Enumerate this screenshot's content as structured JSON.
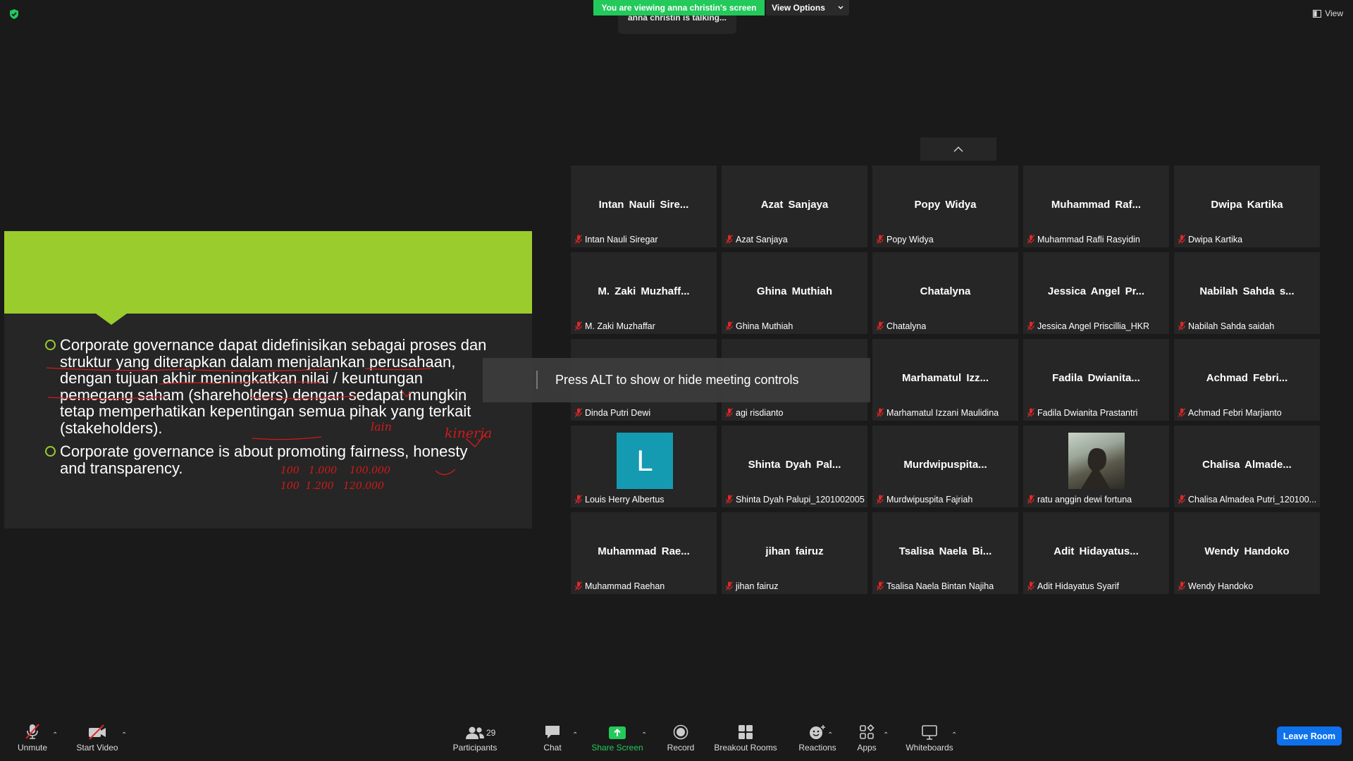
{
  "top": {
    "viewing_banner": "You are viewing anna christin's screen",
    "view_options": "View Options",
    "talking": "anna christin is talking...",
    "view_button": "View"
  },
  "slide": {
    "accent": "#9bcc2e",
    "bullets": [
      "Corporate governance dapat didefinisikan sebagai proses dan struktur yang diterapkan dalam menjalankan perusahaan, dengan tujuan akhir meningkatkan nilai / keuntungan pemegang saham (shareholders) dengan sedapat mungkin tetap memperhatikan kepentingan semua pihak yang terkait (stakeholders).",
      "Corporate governance is about promoting fairness, honesty and transparency."
    ],
    "annotations": {
      "word1": "lain",
      "word2": "kinerja",
      "nums_row1": "100   1.000    100.000",
      "nums_row2": "100  1.200   120.000"
    }
  },
  "tooltip": "Press ALT to show or hide meeting controls",
  "participants": [
    {
      "display": "Intan  Nauli  Sire...",
      "name": "Intan Nauli Siregar"
    },
    {
      "display": "Azat Sanjaya",
      "name": "Azat Sanjaya"
    },
    {
      "display": "Popy Widya",
      "name": "Popy Widya"
    },
    {
      "display": "Muhammad  Raf...",
      "name": "Muhammad Rafli Rasyidin"
    },
    {
      "display": "Dwipa Kartika",
      "name": "Dwipa Kartika"
    },
    {
      "display": "M.  Zaki  Muzhaff...",
      "name": "M. Zaki Muzhaffar"
    },
    {
      "display": "Ghina Muthiah",
      "name": "Ghina Muthiah"
    },
    {
      "display": "Chatalyna",
      "name": "Chatalyna"
    },
    {
      "display": "Jessica  Angel  Pr...",
      "name": "Jessica Angel Priscillia_HKR"
    },
    {
      "display": "Nabilah  Sahda  s...",
      "name": "Nabilah Sahda saidah"
    },
    {
      "display": "",
      "name": "Dinda Putri Dewi"
    },
    {
      "display": "",
      "name": "agi risdianto"
    },
    {
      "display": "Marhamatul  Izz...",
      "name": "Marhamatul Izzani Maulidina"
    },
    {
      "display": "Fadila  Dwianita...",
      "name": "Fadila Dwianita Prastantri"
    },
    {
      "display": "Achmad  Febri...",
      "name": "Achmad Febri Marjianto"
    },
    {
      "display": "",
      "name": "Louis Herry Albertus",
      "avatar_letter": "L"
    },
    {
      "display": "Shinta  Dyah  Pal...",
      "name": "Shinta Dyah Palupi_1201002005"
    },
    {
      "display": "Murdwipuspita...",
      "name": "Murdwipuspita Fajriah"
    },
    {
      "display": "",
      "name": "ratu anggin dewi fortuna",
      "photo": true
    },
    {
      "display": "Chalisa  Almade...",
      "name": "Chalisa Almadea Putri_120100..."
    },
    {
      "display": "Muhammad  Rae...",
      "name": "Muhammad Raehan"
    },
    {
      "display": "jihan fairuz",
      "name": "jihan fairuz"
    },
    {
      "display": "Tsalisa  Naela  Bi...",
      "name": "Tsalisa Naela Bintan Najiha"
    },
    {
      "display": "Adit  Hidayatus...",
      "name": "Adit Hidayatus Syarif"
    },
    {
      "display": "Wendy Handoko",
      "name": "Wendy Handoko"
    }
  ],
  "toolbar": {
    "unmute": "Unmute",
    "start_video": "Start Video",
    "participants": "Participants",
    "participants_count": "29",
    "chat": "Chat",
    "share_screen": "Share Screen",
    "record": "Record",
    "breakout_rooms": "Breakout Rooms",
    "reactions": "Reactions",
    "apps": "Apps",
    "whiteboards": "Whiteboards",
    "leave": "Leave Room"
  },
  "colors": {
    "share_green": "#23c95b",
    "leave_blue": "#0e72ed",
    "mic_muted_red": "#e02828",
    "avatar_teal": "#149bb2"
  }
}
